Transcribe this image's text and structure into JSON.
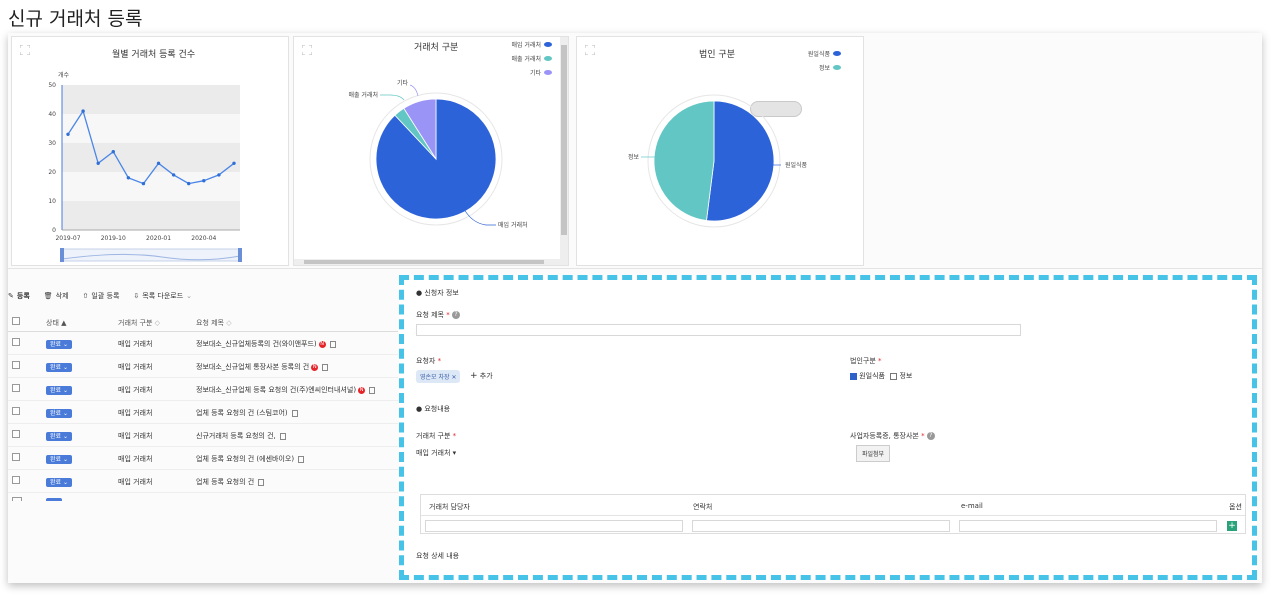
{
  "page_title": "신규 거래처 등록",
  "charts": {
    "line": {
      "title": "월별 거래처 등록 건수",
      "ylabel": "개수",
      "y_ticks": [
        "50",
        "40",
        "30",
        "20",
        "10",
        "0"
      ],
      "x_ticks": [
        "2019-07",
        "2019-10",
        "2020-01",
        "2020-04"
      ]
    },
    "pie1": {
      "title": "거래처 구분",
      "legend": [
        {
          "label": "매입 거래처",
          "color": "#2d63d8"
        },
        {
          "label": "매출 거래처",
          "color": "#62c7c4"
        },
        {
          "label": "기타",
          "color": "#9b94f7"
        }
      ],
      "labels": {
        "main": "매입 거래처",
        "second": "매출 거래처",
        "third": "기타"
      }
    },
    "pie2": {
      "title": "법인 구분",
      "legend": [
        {
          "label": "원일식품",
          "color": "#2d63d8"
        },
        {
          "label": "정보",
          "color": "#62c7c4"
        }
      ],
      "labels": {
        "main": "원일식품",
        "second": "정보"
      }
    }
  },
  "chart_data": [
    {
      "type": "line",
      "title": "월별 거래처 등록 건수",
      "ylabel": "개수",
      "ylim": [
        0,
        50
      ],
      "x": [
        "2019-07",
        "2019-08",
        "2019-09",
        "2019-10",
        "2019-11",
        "2019-12",
        "2020-01",
        "2020-02",
        "2020-03",
        "2020-04",
        "2020-05",
        "2020-06"
      ],
      "values": [
        33,
        41,
        23,
        27,
        18,
        16,
        23,
        19,
        16,
        17,
        19,
        23
      ]
    },
    {
      "type": "pie",
      "title": "거래처 구분",
      "categories": [
        "매입 거래처",
        "매출 거래처",
        "기타"
      ],
      "values": [
        88,
        3,
        9
      ]
    },
    {
      "type": "pie",
      "title": "법인 구분",
      "categories": [
        "원일식품",
        "정보"
      ],
      "values": [
        52,
        48
      ]
    }
  ],
  "toolbar": {
    "register": "등록",
    "delete": "삭제",
    "bulk": "일괄 등록",
    "download": "목록 다운로드"
  },
  "table": {
    "headers": [
      "상태",
      "거래처 구분",
      "요청 제목"
    ],
    "rows": [
      {
        "status": "완료",
        "type": "매입 거래처",
        "title": "정보대소_신규업체등록의 건(와이앤푸드)",
        "red": true
      },
      {
        "status": "완료",
        "type": "매입 거래처",
        "title": "정보대소_신규업체 통장사본 등록의 건",
        "red": true
      },
      {
        "status": "완료",
        "type": "매입 거래처",
        "title": "정보대소_신규업체 등록 요청의 건(주)엔씨인터내셔널)",
        "red": true
      },
      {
        "status": "완료",
        "type": "매입 거래처",
        "title": "업체 등록 요청의 건 (스팀코어)",
        "red": false
      },
      {
        "status": "완료",
        "type": "매입 거래처",
        "title": "신규거래처 등록 요청의 건,",
        "red": false
      },
      {
        "status": "완료",
        "type": "매입 거래처",
        "title": "업체 등록 요청의 건 (에센바이오)",
        "red": false
      },
      {
        "status": "완료",
        "type": "매입 거래처",
        "title": "업체 등록 요청의 건",
        "red": false
      }
    ]
  },
  "form": {
    "section1": "신청자 정보",
    "req_title_label": "요청 제목",
    "requester_label": "요청자",
    "requester_tag": "영손모 차장",
    "add_label": "추가",
    "corp_label": "법인구분",
    "corp_opt1": "원일식품",
    "corp_opt2": "정보",
    "section2": "요청내용",
    "vendor_type_label": "거래처 구분",
    "vendor_type_value": "매입 거래처",
    "bizreg_label": "사업자등록증, 통장사본",
    "file_btn": "파일첨부",
    "grid_headers": [
      "거래처 담당자",
      "연락처",
      "e-mail",
      "옵션"
    ],
    "detail_label": "요청 상세 내용"
  }
}
